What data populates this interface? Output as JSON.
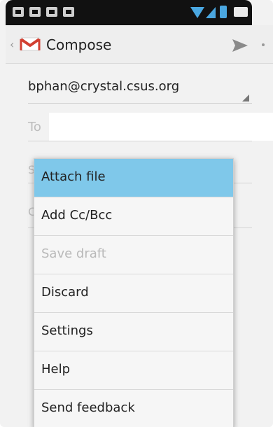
{
  "action_bar": {
    "title": "Compose"
  },
  "status_bar": {
    "icons": [
      "image-icon",
      "check-icon",
      "mail-icon",
      "shopping-bag-icon",
      "wifi-icon",
      "signal-icon",
      "battery-icon"
    ]
  },
  "compose": {
    "from": "bphan@crystal.csus.org",
    "to_label": "To",
    "to_value": "",
    "subject_placeholder": "S",
    "body_placeholder": "C"
  },
  "menu": {
    "items": [
      {
        "label": "Attach file",
        "state": "highlighted"
      },
      {
        "label": "Add Cc/Bcc",
        "state": "enabled"
      },
      {
        "label": "Save draft",
        "state": "disabled"
      },
      {
        "label": "Discard",
        "state": "enabled"
      },
      {
        "label": "Settings",
        "state": "enabled"
      },
      {
        "label": "Help",
        "state": "enabled"
      },
      {
        "label": "Send feedback",
        "state": "enabled"
      }
    ]
  },
  "colors": {
    "accent_highlight": "#7fc8ea",
    "status_icons": "#4aa7e0",
    "gmail_red": "#d23f31"
  }
}
